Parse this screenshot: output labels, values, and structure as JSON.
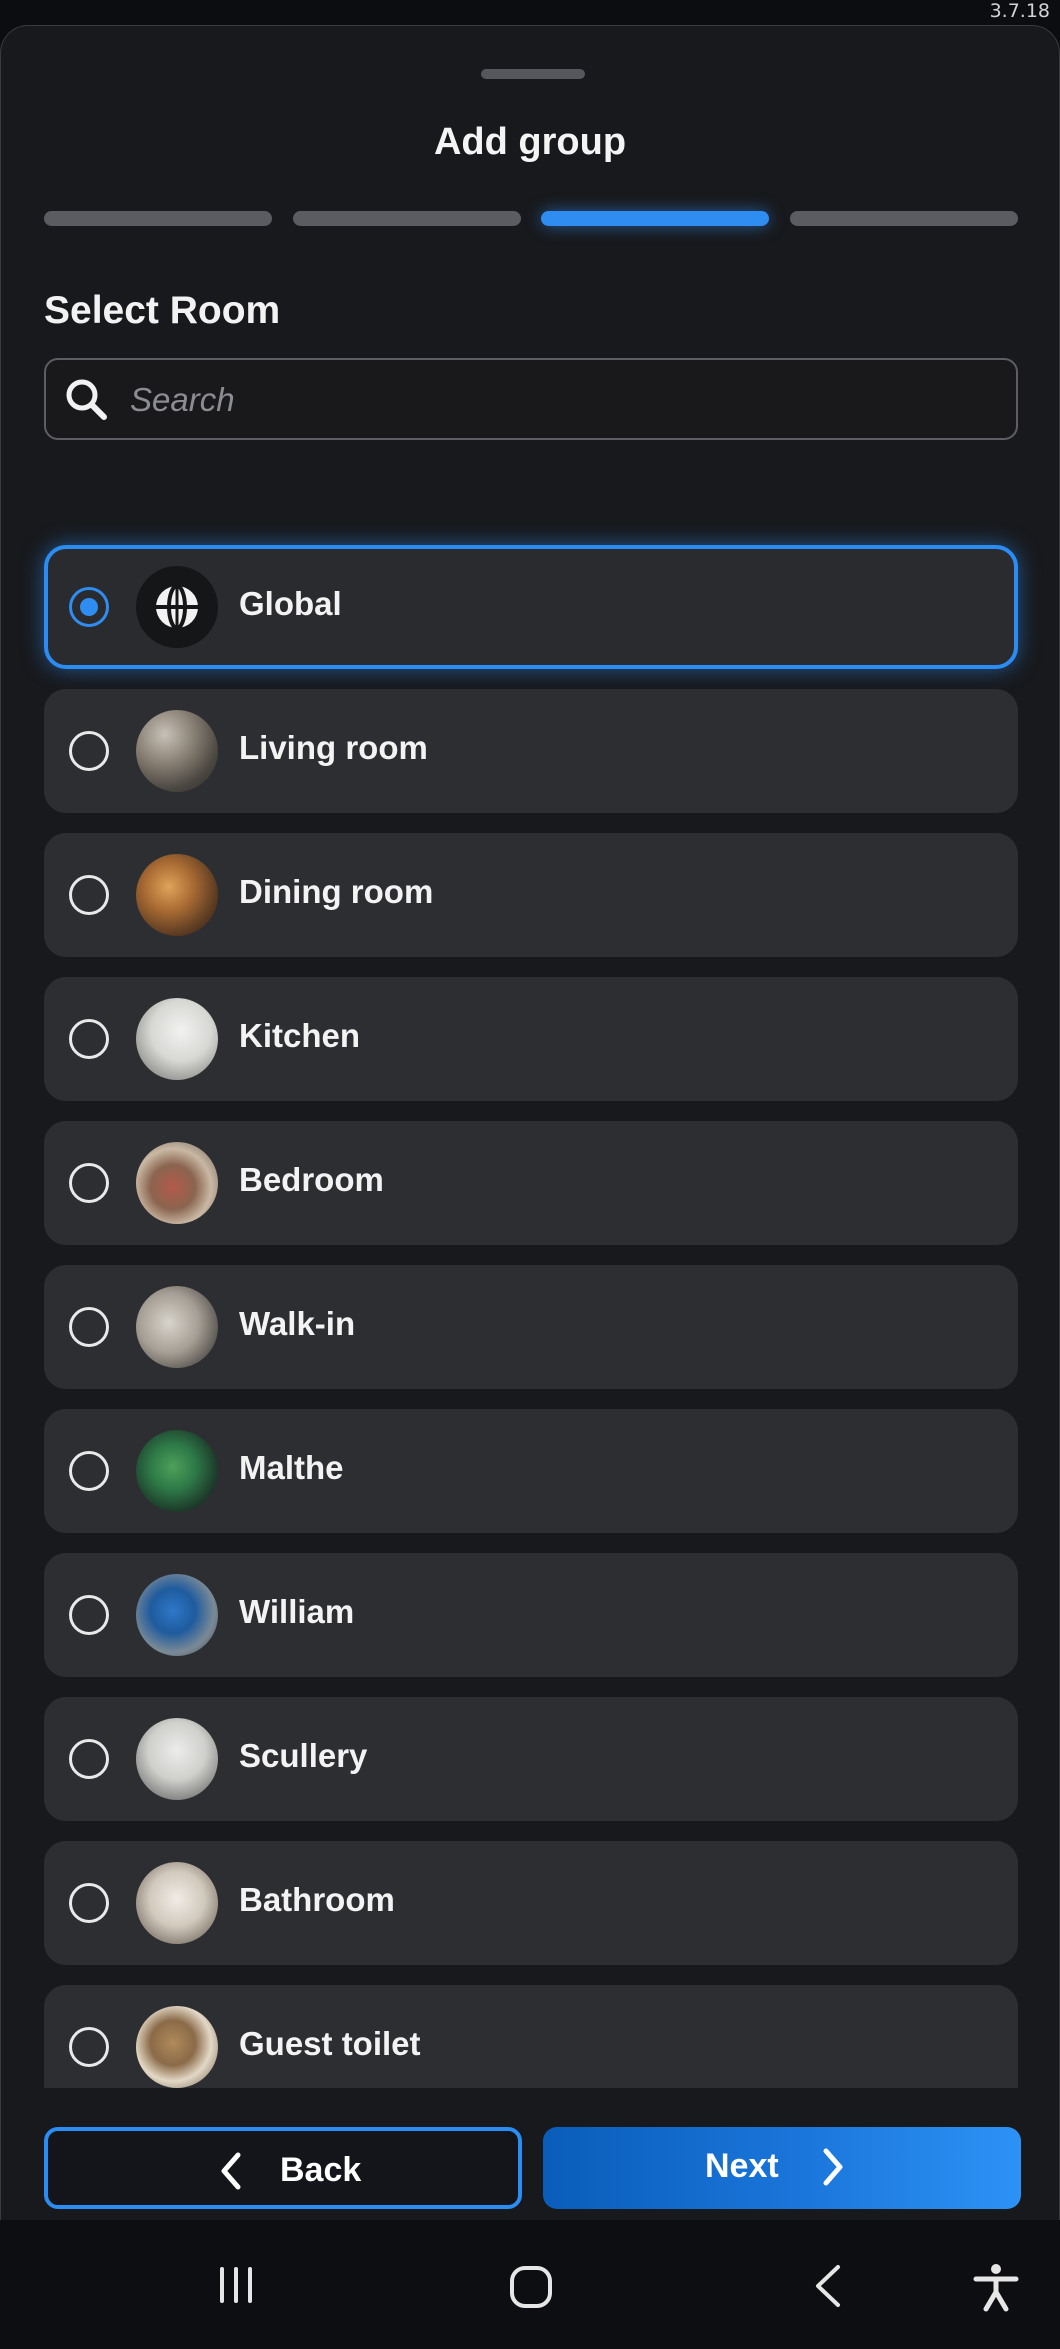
{
  "status_bar": {
    "version": "3.7.18"
  },
  "sheet": {
    "title": "Add group",
    "steps_total": 4,
    "active_step": 3
  },
  "room_section": {
    "title": "Select Room",
    "search_placeholder": "Search",
    "search_value": ""
  },
  "rooms": [
    {
      "label": "Global",
      "selected": true,
      "icon": "globe-icon"
    },
    {
      "label": "Living room",
      "selected": false
    },
    {
      "label": "Dining room",
      "selected": false
    },
    {
      "label": "Kitchen",
      "selected": false
    },
    {
      "label": "Bedroom",
      "selected": false
    },
    {
      "label": "Walk-in",
      "selected": false
    },
    {
      "label": "Malthe",
      "selected": false
    },
    {
      "label": "William",
      "selected": false
    },
    {
      "label": "Scullery",
      "selected": false
    },
    {
      "label": "Bathroom",
      "selected": false
    },
    {
      "label": "Guest toilet",
      "selected": false
    }
  ],
  "footer": {
    "back_label": "Back",
    "next_label": "Next"
  },
  "colors": {
    "accent": "#2f8cf0",
    "sheet_bg": "#18191c",
    "row_bg": "#2d2e32"
  },
  "system_nav": {
    "icons": [
      "recents-icon",
      "home-icon",
      "back-nav-icon",
      "accessibility-icon"
    ]
  }
}
